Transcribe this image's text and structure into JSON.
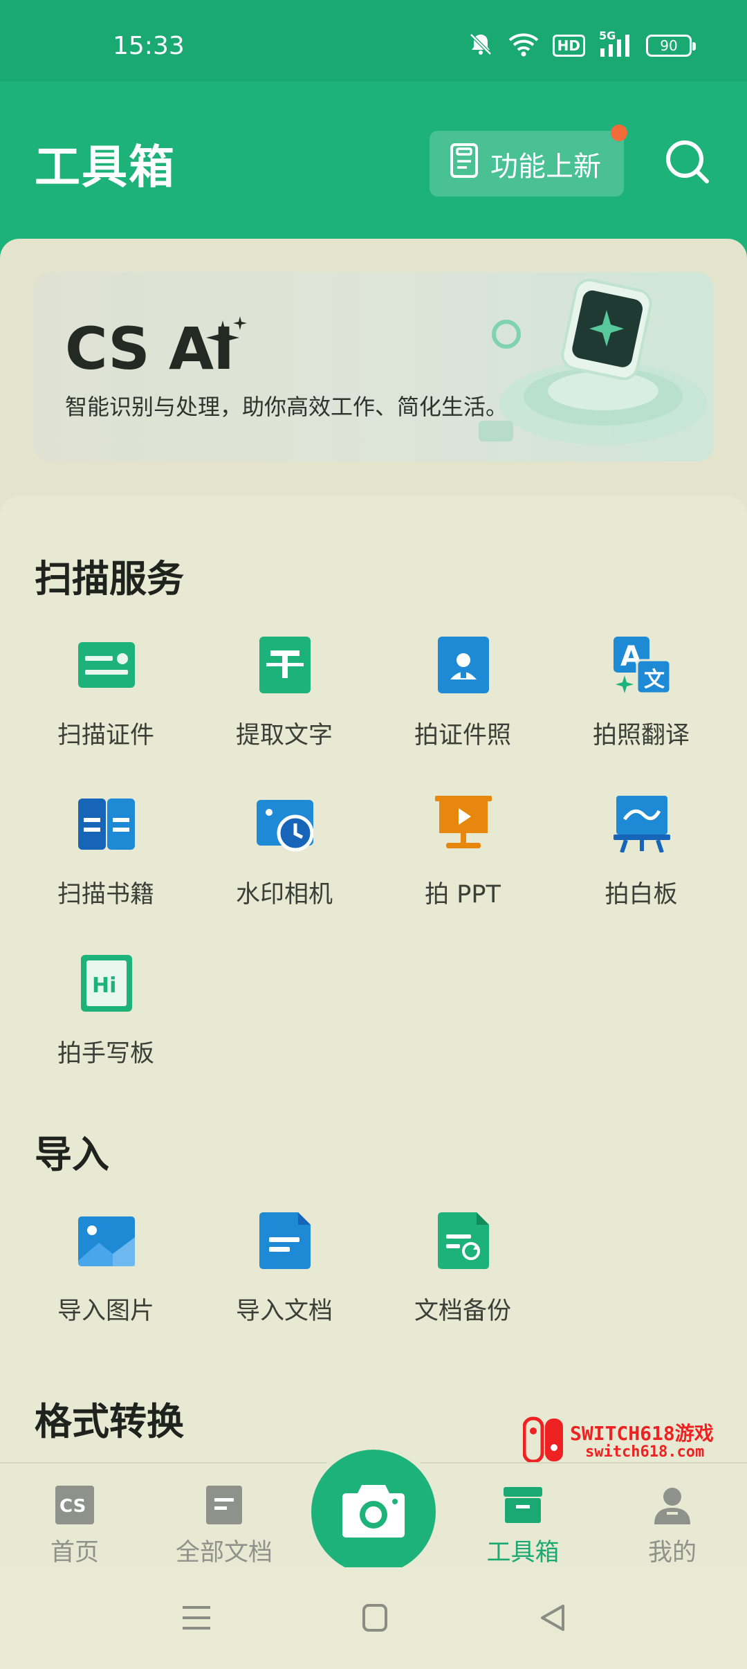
{
  "status_bar": {
    "time": "15:33",
    "hd": "HD",
    "signal_label": "5G",
    "battery": "90"
  },
  "header": {
    "title": "工具箱",
    "new_feature_label": "功能上新"
  },
  "banner": {
    "title": "CS AI",
    "subtitle": "智能识别与处理，助你高效工作、简化生活。"
  },
  "sections": {
    "scan": {
      "title": "扫描服务",
      "items": [
        {
          "label": "扫描证件",
          "icon": "id-card-icon"
        },
        {
          "label": "提取文字",
          "icon": "text-extract-icon"
        },
        {
          "label": "拍证件照",
          "icon": "id-photo-icon"
        },
        {
          "label": "拍照翻译",
          "icon": "translate-icon"
        },
        {
          "label": "扫描书籍",
          "icon": "book-icon"
        },
        {
          "label": "水印相机",
          "icon": "watermark-camera-icon"
        },
        {
          "label": "拍 PPT",
          "icon": "ppt-icon"
        },
        {
          "label": "拍白板",
          "icon": "whiteboard-icon"
        },
        {
          "label": "拍手写板",
          "icon": "handwriting-board-icon"
        }
      ]
    },
    "import": {
      "title": "导入",
      "items": [
        {
          "label": "导入图片",
          "icon": "import-image-icon"
        },
        {
          "label": "导入文档",
          "icon": "import-doc-icon"
        },
        {
          "label": "文档备份",
          "icon": "doc-backup-icon"
        }
      ]
    },
    "convert": {
      "title": "格式转换"
    }
  },
  "bottom_nav": {
    "home": "首页",
    "all_docs": "全部文档",
    "toolbox": "工具箱",
    "mine": "我的",
    "home_icon_text": "CS"
  },
  "watermark": {
    "line1": "SWITCH618游戏",
    "line2": "switch618.com"
  },
  "colors": {
    "brand": "#1db27a",
    "accent_dot": "#f26b3a",
    "blue": "#1e8ad6",
    "orange": "#e8870e"
  }
}
